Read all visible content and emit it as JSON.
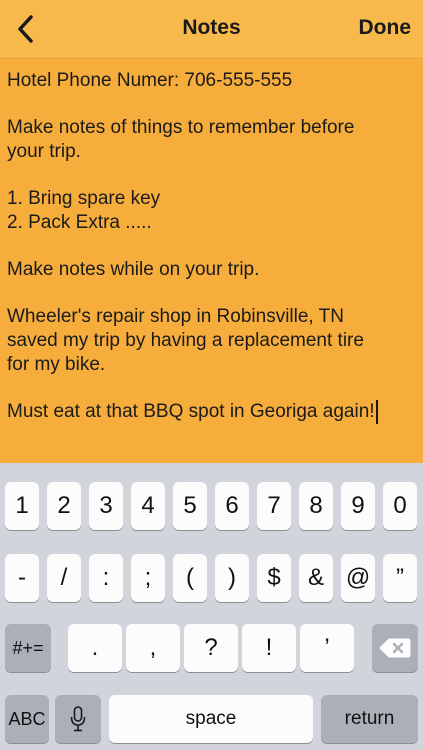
{
  "navbar": {
    "title": "Notes",
    "done_label": "Done",
    "back_icon": "chevron-left-icon"
  },
  "note": {
    "lines": [
      "Hotel Phone Numer: 706-555-555",
      "",
      "Make notes of things to remember before",
      "your trip.",
      "",
      "1. Bring spare key",
      "2. Pack Extra .....",
      "",
      "Make notes while on your trip.",
      "",
      "Wheeler's repair shop in Robinsville, TN",
      "saved my trip by having a replacement tire",
      "for my bike.",
      "",
      "Must eat at that BBQ spot in Georiga again!"
    ]
  },
  "keyboard": {
    "row1": [
      "1",
      "2",
      "3",
      "4",
      "5",
      "6",
      "7",
      "8",
      "9",
      "0"
    ],
    "row2": [
      "-",
      "/",
      ":",
      ";",
      "(",
      ")",
      "$",
      "&",
      "@",
      "”"
    ],
    "row3_left": "#+=",
    "row3": [
      ".",
      ",",
      "?",
      "!",
      "’"
    ],
    "backspace_icon": "backspace-icon",
    "abc_label": "ABC",
    "mic_icon": "microphone-icon",
    "space_label": "space",
    "return_label": "return"
  },
  "colors": {
    "navbar_bg": "#f8b94c",
    "note_bg": "#f6ad3c",
    "keyboard_bg": "#d1d5db"
  }
}
